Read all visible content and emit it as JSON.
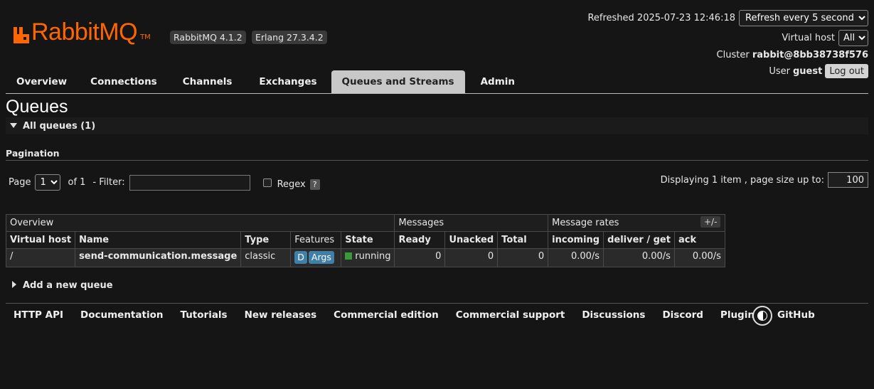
{
  "logo": {
    "text_rabbit": "Rabbit",
    "text_mq": "MQ",
    "tm": "TM"
  },
  "versions": {
    "rabbitmq": "RabbitMQ 4.1.2",
    "erlang": "Erlang 27.3.4.2"
  },
  "header": {
    "refreshed": "Refreshed 2025-07-23 12:46:18",
    "refresh_option": "Refresh every 5 seconds",
    "vhost_label": "Virtual host",
    "vhost_value": "All",
    "cluster_label": "Cluster",
    "cluster_value": "rabbit@8bb38738f576",
    "user_label": "User",
    "user_value": "guest",
    "logout": "Log out"
  },
  "tabs": [
    {
      "label": "Overview"
    },
    {
      "label": "Connections"
    },
    {
      "label": "Channels"
    },
    {
      "label": "Exchanges"
    },
    {
      "label": "Queues and Streams",
      "active": true
    },
    {
      "label": "Admin"
    }
  ],
  "page_title": "Queues",
  "section": {
    "all_queues": "All queues (1)",
    "add_queue": "Add a new queue"
  },
  "pagination": {
    "title": "Pagination",
    "page_label": "Page",
    "page_value": "1",
    "of_label": "of 1",
    "filter_label": "- Filter:",
    "filter_value": "",
    "regex_label": "Regex",
    "help": "?",
    "displaying": "Displaying 1 item , page size up to:",
    "page_size": "100"
  },
  "table": {
    "groups": {
      "overview": "Overview",
      "messages": "Messages",
      "rates": "Message rates"
    },
    "columns": {
      "vhost": "Virtual host",
      "name": "Name",
      "type": "Type",
      "features": "Features",
      "state": "State",
      "ready": "Ready",
      "unacked": "Unacked",
      "total": "Total",
      "incoming": "incoming",
      "deliver": "deliver / get",
      "ack": "ack"
    },
    "row": {
      "vhost": "/",
      "name": "send-communication.message",
      "type": "classic",
      "feature_d": "D",
      "feature_args": "Args",
      "state": "running",
      "ready": "0",
      "unacked": "0",
      "total": "0",
      "incoming": "0.00/s",
      "deliver": "0.00/s",
      "ack": "0.00/s"
    },
    "toggle": "+/-"
  },
  "footer": [
    "HTTP API",
    "Documentation",
    "Tutorials",
    "New releases",
    "Commercial edition",
    "Commercial support",
    "Discussions",
    "Discord",
    "Plugins",
    "GitHub"
  ],
  "colors": {
    "brand": "#ff6600",
    "state_running": "#3a9a3a",
    "feature_badge": "#3f7fa8"
  }
}
